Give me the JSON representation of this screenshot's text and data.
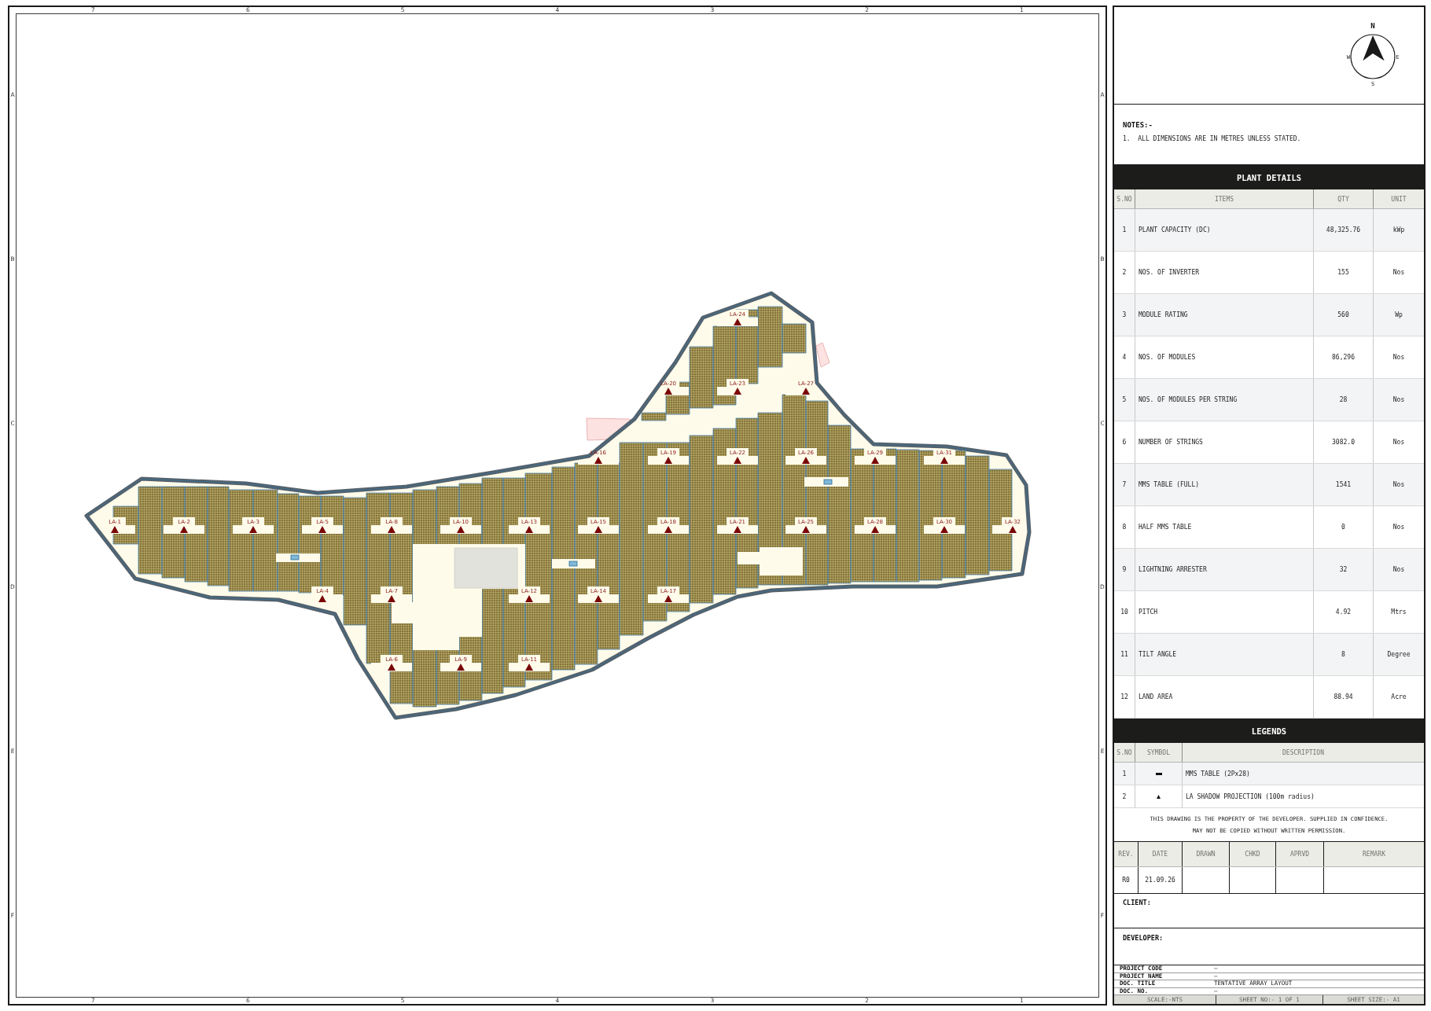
{
  "frame": {
    "top_refs": [
      "7",
      "6",
      "5",
      "4",
      "3",
      "2",
      "1"
    ],
    "left_refs": [
      "A",
      "B",
      "C",
      "D",
      "E",
      "F"
    ],
    "right_refs": [
      "A",
      "B",
      "C",
      "D",
      "E",
      "F"
    ],
    "bottom_refs": [
      "7",
      "6",
      "5",
      "4",
      "3",
      "2",
      "1"
    ]
  },
  "site_plan": {
    "markers": [
      {
        "label": "LA-24"
      },
      {
        "label": "LA-20"
      },
      {
        "label": "LA-23"
      },
      {
        "label": "LA-27"
      },
      {
        "label": "LA-16"
      },
      {
        "label": "LA-19"
      },
      {
        "label": "LA-22"
      },
      {
        "label": "LA-26"
      },
      {
        "label": "LA-29"
      },
      {
        "label": "LA-31"
      },
      {
        "label": "LA-1"
      },
      {
        "label": "LA-2"
      },
      {
        "label": "LA-3"
      },
      {
        "label": "LA-5"
      },
      {
        "label": "LA-8"
      },
      {
        "label": "LA-10"
      },
      {
        "label": "LA-13"
      },
      {
        "label": "LA-15"
      },
      {
        "label": "LA-18"
      },
      {
        "label": "LA-21"
      },
      {
        "label": "LA-25"
      },
      {
        "label": "LA-28"
      },
      {
        "label": "LA-30"
      },
      {
        "label": "LA-32"
      },
      {
        "label": "LA-4"
      },
      {
        "label": "LA-7"
      },
      {
        "label": "LA-12"
      },
      {
        "label": "LA-14"
      },
      {
        "label": "LA-17"
      },
      {
        "label": "LA-6"
      },
      {
        "label": "LA-9"
      },
      {
        "label": "LA-11"
      }
    ]
  },
  "compass": {
    "north": "N",
    "west": "W",
    "east": "E",
    "south": "S"
  },
  "notes": {
    "title": "NOTES:-",
    "items": [
      "1.  ALL DIMENSIONS ARE IN METRES UNLESS STATED."
    ]
  },
  "plant_details": {
    "title": "PLANT DETAILS",
    "columns": [
      "S.NO",
      "ITEMS",
      "QTY",
      "UNIT"
    ],
    "rows": [
      {
        "s_no": "1",
        "item": "PLANT CAPACITY (DC)",
        "qty": "48,325.76",
        "unit": "kWp"
      },
      {
        "s_no": "2",
        "item": "NOS. OF INVERTER",
        "qty": "155",
        "unit": "Nos"
      },
      {
        "s_no": "3",
        "item": "MODULE RATING",
        "qty": "560",
        "unit": "Wp"
      },
      {
        "s_no": "4",
        "item": "NOS. OF MODULES",
        "qty": "86,296",
        "unit": "Nos"
      },
      {
        "s_no": "5",
        "item": "NOS. OF MODULES PER STRING",
        "qty": "28",
        "unit": "Nos"
      },
      {
        "s_no": "6",
        "item": "NUMBER OF STRINGS",
        "qty": "3082.0",
        "unit": "Nos"
      },
      {
        "s_no": "7",
        "item": "MMS TABLE (FULL)",
        "qty": "1541",
        "unit": "Nos"
      },
      {
        "s_no": "8",
        "item": "HALF MMS TABLE",
        "qty": "0",
        "unit": "Nos"
      },
      {
        "s_no": "9",
        "item": "LIGHTNING ARRESTER",
        "qty": "32",
        "unit": "Nos"
      },
      {
        "s_no": "10",
        "item": "PITCH",
        "qty": "4.92",
        "unit": "Mtrs"
      },
      {
        "s_no": "11",
        "item": "TILT ANGLE",
        "qty": "8",
        "unit": "Degree"
      },
      {
        "s_no": "12",
        "item": "LAND AREA",
        "qty": "88.94",
        "unit": "Acre"
      }
    ]
  },
  "legends": {
    "title": "LEGENDS",
    "columns": [
      "S.NO",
      "SYMBOL",
      "DESCRIPTION"
    ],
    "rows": [
      {
        "s_no": "1",
        "kind": "bar",
        "description": "MMS TABLE (2Px28)"
      },
      {
        "s_no": "2",
        "kind": "triangle",
        "description": "LA SHADOW PROJECTION (100m radius)"
      }
    ]
  },
  "disclaimer": [
    "THIS DRAWING IS THE PROPERTY OF THE DEVELOPER. SUPPLIED IN CONFIDENCE.",
    "MAY NOT BE COPIED WITHOUT WRITTEN PERMISSION."
  ],
  "revisions": {
    "columns": [
      "REV.",
      "DATE",
      "DRAWN",
      "CHKD",
      "APRVD",
      "REMARK"
    ],
    "rows": [
      {
        "rev": "R0",
        "date": "21.09.26"
      }
    ]
  },
  "client": {
    "label": "CLIENT:"
  },
  "developer": {
    "label": "DEVELOPER:"
  },
  "project_info": [
    {
      "label": "PROJECT CODE",
      "value": "–"
    },
    {
      "label": "PROJECT NAME",
      "value": "–"
    },
    {
      "label": "DOC. TITLE",
      "value": "TENTATIVE ARRAY LAYOUT"
    },
    {
      "label": "DOC. NO.",
      "value": "–"
    }
  ],
  "sheet_info": [
    "SCALE:-NTS",
    "SHEET NO:- 1 OF 1",
    "SHEET SIZE:- A1"
  ]
}
